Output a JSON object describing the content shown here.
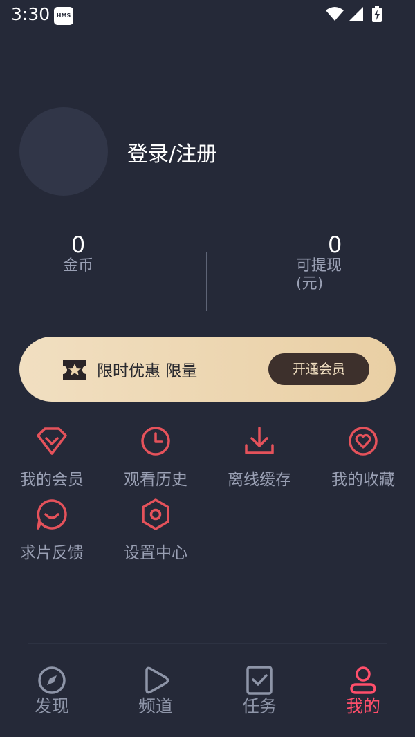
{
  "status_bar": {
    "time": "3:30",
    "hms_badge": "HMS"
  },
  "profile": {
    "login_label": "登录/注册"
  },
  "stats": {
    "coins": {
      "value": "0",
      "label": "金币"
    },
    "withdrawable": {
      "value": "0",
      "label_line1": "可提现",
      "label_line2": "(元)"
    }
  },
  "vip_banner": {
    "promo_text": "限时优惠 限量",
    "button_label": "开通会员"
  },
  "menu": {
    "items": [
      {
        "label": "我的会员",
        "icon": "diamond-icon"
      },
      {
        "label": "观看历史",
        "icon": "clock-icon"
      },
      {
        "label": "离线缓存",
        "icon": "download-icon"
      },
      {
        "label": "我的收藏",
        "icon": "heart-icon"
      },
      {
        "label": "求片反馈",
        "icon": "smile-chat-icon"
      },
      {
        "label": "设置中心",
        "icon": "hexagon-gear-icon"
      }
    ]
  },
  "bottom_nav": {
    "items": [
      {
        "label": "发现",
        "icon": "compass-icon"
      },
      {
        "label": "频道",
        "icon": "play-icon"
      },
      {
        "label": "任务",
        "icon": "task-check-icon"
      },
      {
        "label": "我的",
        "icon": "person-icon"
      }
    ],
    "active_index": 3
  },
  "colors": {
    "background": "#252938",
    "accent_red": "#ff4f6b",
    "icon_red": "#e5525b",
    "muted_text": "#9aa0b4",
    "vip_gold": "#e9cfa4",
    "vip_button": "#3d302c"
  }
}
